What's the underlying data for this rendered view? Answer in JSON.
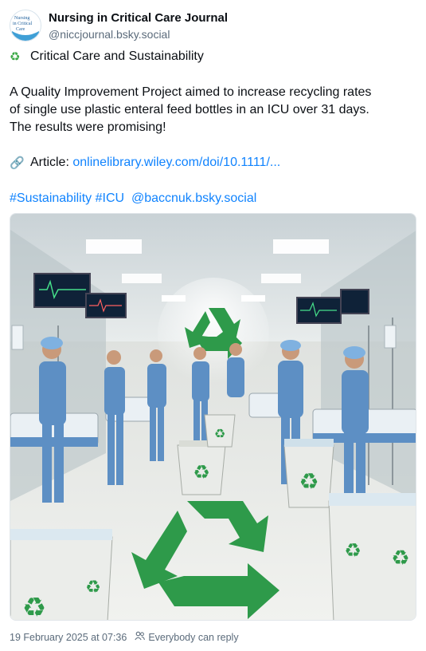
{
  "account": {
    "display_name": "Nursing in Critical Care Journal",
    "handle": "@niccjournal.bsky.social",
    "avatar_text": [
      "Nursing",
      "in Critical",
      "Care"
    ]
  },
  "post": {
    "title_emoji": "recycle-icon",
    "title": "Critical Care and Sustainability",
    "body_lines": [
      "A Quality Improvement Project aimed to increase recycling rates",
      "of single use plastic enteral feed bottles in an ICU over 31 days.",
      "The results were promising!"
    ],
    "article_emoji": "link-icon",
    "article_label": "Article:",
    "article_link": "onlinelibrary.wiley.com/doi/10.1111/...",
    "tags": [
      "#Sustainability",
      "#ICU"
    ],
    "mention": "@baccnuk.bsky.social"
  },
  "image": {
    "description_icon": "icu-recycling-illustration"
  },
  "footer": {
    "timestamp": "19 February 2025 at 07:36",
    "reply_setting": "Everybody can reply"
  },
  "colors": {
    "link": "#1083fe",
    "muted": "#5b6b7b",
    "text": "#0b0f14",
    "recycle_green": "#2e9a4a",
    "scrubs_blue": "#5d8fc4"
  }
}
